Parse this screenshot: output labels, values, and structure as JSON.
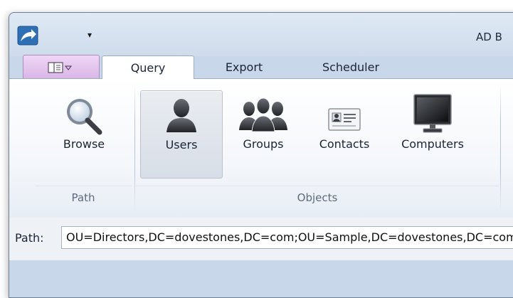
{
  "window": {
    "title": "AD B"
  },
  "quick_access": {
    "dropdown_glyph": "▾"
  },
  "tabs": [
    {
      "label": "Query",
      "active": true
    },
    {
      "label": "Export",
      "active": false
    },
    {
      "label": "Scheduler",
      "active": false
    }
  ],
  "ribbon": {
    "groups": {
      "path": {
        "label": "Path",
        "buttons": [
          {
            "label": "Browse",
            "icon": "magnifier-icon"
          }
        ]
      },
      "objects": {
        "label": "Objects",
        "buttons": [
          {
            "label": "Users",
            "icon": "user-icon",
            "selected": true
          },
          {
            "label": "Groups",
            "icon": "group-icon",
            "selected": false
          },
          {
            "label": "Contacts",
            "icon": "contact-card-icon",
            "selected": false
          },
          {
            "label": "Computers",
            "icon": "monitor-icon",
            "selected": false
          }
        ]
      }
    }
  },
  "path_bar": {
    "label": "Path:",
    "value": "OU=Directors,DC=dovestones,DC=com;OU=Sample,DC=dovestones,DC=com"
  },
  "colors": {
    "app_menu": "#d9b6e6",
    "ribbon_bg": "#f4f7fb",
    "titlebar": "#dfe9f5"
  }
}
